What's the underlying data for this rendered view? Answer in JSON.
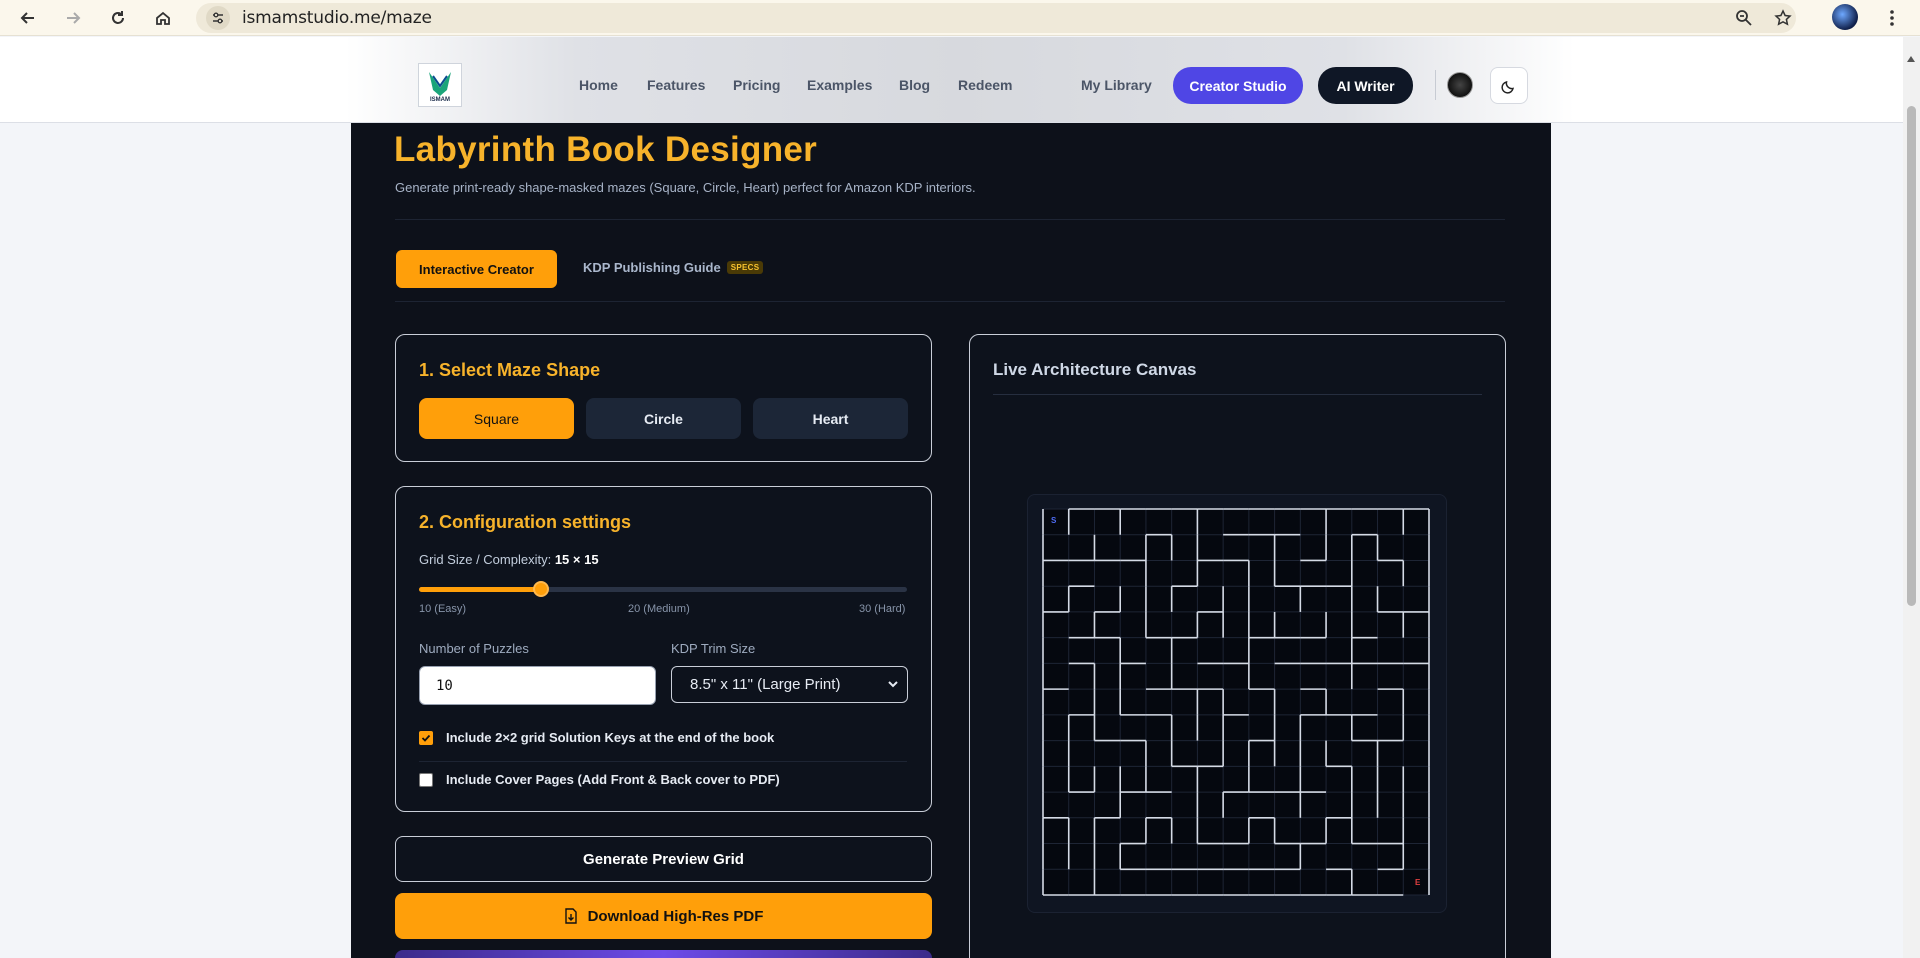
{
  "browser": {
    "url": "ismamstudio.me/maze"
  },
  "header": {
    "nav": [
      "Home",
      "Features",
      "Pricing",
      "Examples",
      "Blog",
      "Redeem"
    ],
    "my_library": "My Library",
    "creator_studio": "Creator Studio",
    "ai_writer": "AI Writer",
    "logo_text": "ISMAM"
  },
  "page": {
    "title": "Labyrinth Book Designer",
    "subtitle": "Generate print-ready shape-masked mazes (Square, Circle, Heart) perfect for Amazon KDP interiors.",
    "tabs": {
      "active": "Interactive Creator",
      "guide": "KDP Publishing Guide",
      "guide_badge": "SPECS"
    }
  },
  "shape_card": {
    "title": "1. Select Maze Shape",
    "shapes": [
      "Square",
      "Circle",
      "Heart"
    ],
    "selected": "Square"
  },
  "config": {
    "title": "2. Configuration settings",
    "grid_label": "Grid Size / Complexity:",
    "grid_value": "15 × 15",
    "slider_fraction": 0.25,
    "ticks": [
      "10 (Easy)",
      "20 (Medium)",
      "30 (Hard)"
    ],
    "puzzles_label": "Number of Puzzles",
    "puzzles_value": "10",
    "trim_label": "KDP Trim Size",
    "trim_value": "8.5\" x 11\" (Large Print)",
    "solution_keys": "Include 2×2 grid Solution Keys at the end of the book",
    "solution_keys_checked": true,
    "cover_pages": "Include Cover Pages (Add Front & Back cover to PDF)",
    "cover_pages_checked": false
  },
  "actions": {
    "preview": "Generate Preview Grid",
    "download": "Download High-Res PDF"
  },
  "canvas": {
    "title": "Live Architecture Canvas",
    "start_marker": "S",
    "end_marker": "E",
    "grid_size": 15
  },
  "colors": {
    "accent": "#ff9f0a",
    "title": "#f7b32b",
    "panel": "#0d111a",
    "creator_btn": "#4f46e5"
  }
}
